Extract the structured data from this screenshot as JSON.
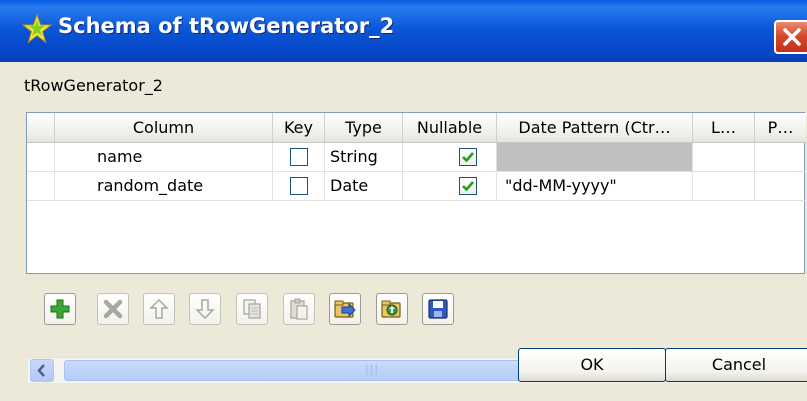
{
  "window": {
    "title": "Schema of tRowGenerator_2",
    "close_label": "×",
    "colors": {
      "titlebar": "#0a5de4",
      "close": "#d4452a",
      "check": "#21a121"
    }
  },
  "component_label": "tRowGenerator_2",
  "table": {
    "columns": [
      "Column",
      "Key",
      "Type",
      "Nullable",
      "Date Pattern (Ctr…",
      "L…",
      "P…"
    ],
    "rows": [
      {
        "column": "name",
        "key": false,
        "type": "String",
        "nullable": true,
        "date_pattern": ""
      },
      {
        "column": "random_date",
        "key": false,
        "type": "Date",
        "nullable": true,
        "date_pattern": "\"dd-MM-yyyy\""
      }
    ]
  },
  "scrollbar": {
    "thumb_grip": "|||"
  },
  "toolbar": {
    "buttons": [
      {
        "icon": "add-icon",
        "enabled": true
      },
      {
        "icon": "delete-icon",
        "enabled": false
      },
      {
        "icon": "move-up-icon",
        "enabled": false
      },
      {
        "icon": "move-down-icon",
        "enabled": false
      },
      {
        "icon": "copy-icon",
        "enabled": false
      },
      {
        "icon": "paste-icon",
        "enabled": false
      },
      {
        "icon": "import-icon",
        "enabled": true
      },
      {
        "icon": "export-icon",
        "enabled": true
      },
      {
        "icon": "save-icon",
        "enabled": true
      }
    ]
  },
  "buttons": {
    "ok": "OK",
    "cancel": "Cancel"
  }
}
